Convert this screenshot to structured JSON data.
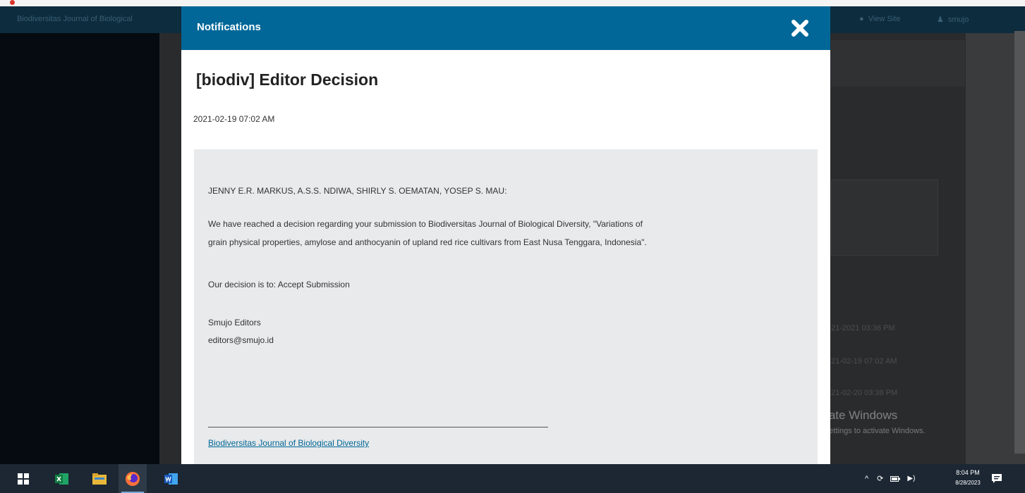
{
  "modal": {
    "header": "Notifications",
    "subject": "[biodiv] Editor Decision",
    "date": "2021-02-19 07:02 AM",
    "body": {
      "greeting": "JENNY E.R. MARKUS, A.S.S. NDIWA, SHIRLY S. OEMATAN, YOSEP S. MAU:",
      "paragraph_line1": "We have reached a decision regarding your submission to Biodiversitas Journal of Biological Diversity, \"Variations of",
      "paragraph_line2": "grain physical properties, amylose and anthocyanin of upland red rice cultivars from East Nusa Tenggara, Indonesia\".",
      "decision": "Our decision is to: Accept Submission",
      "signature_name": "Smujo Editors",
      "signature_email": "editors@smujo.id",
      "footer_link": "Biodiversitas Journal of Biological Diversity"
    }
  },
  "background": {
    "site_title": "Biodiversitas Journal of Biological",
    "view_site": "View Site",
    "user": "smujo",
    "timestamps": [
      "21-2021 03:36 PM",
      "21-02-19 07:02 AM",
      "21-02-20 03:38 PM"
    ]
  },
  "watermark": {
    "title": "Activate Windows",
    "subtitle": "Go to Settings to activate Windows."
  },
  "taskbar": {
    "time": "8:04 PM",
    "date": "8/28/2023"
  },
  "colors": {
    "modal_header": "#006798",
    "link": "#006798",
    "body_background": "#e8eaeb",
    "taskbar": "#1c2733"
  }
}
